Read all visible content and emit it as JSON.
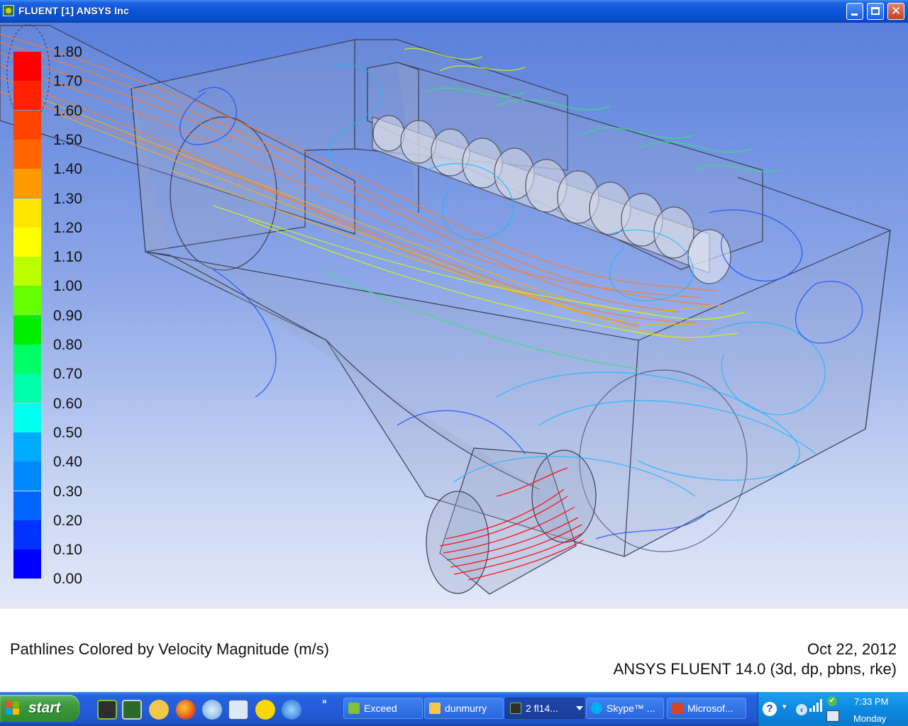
{
  "window": {
    "title": "FLUENT [1] ANSYS Inc",
    "buttons": [
      "minimize",
      "maximize",
      "close"
    ]
  },
  "legend": {
    "colors": [
      "#ff0000",
      "#ff2200",
      "#ff4400",
      "#ff6600",
      "#ff9900",
      "#ffc200",
      "#ffe600",
      "#ffff00",
      "#bbff00",
      "#66ff00",
      "#00ee00",
      "#00ff66",
      "#00ffaa",
      "#00ffee",
      "#00d4ff",
      "#00aaff",
      "#0088ff",
      "#0066ff",
      "#0033ff",
      "#0000ff"
    ],
    "labels": [
      "1.80",
      "1.70",
      "1.60",
      "1.50",
      "1.40",
      "1.30",
      "1.20",
      "1.10",
      "1.00",
      "0.90",
      "0.80",
      "0.70",
      "0.60",
      "0.50",
      "0.40",
      "0.30",
      "0.20",
      "0.10",
      "0.00"
    ]
  },
  "caption": {
    "title": "Pathlines Colored by Velocity Magnitude (m/s)",
    "date": "Oct 22, 2012",
    "version": "ANSYS FLUENT 14.0 (3d, dp, pbns, rke)"
  },
  "taskbar": {
    "start_label": "start",
    "quick_launch_more": "»",
    "quick_launch_icons": [
      "exceed-icon",
      "graphics-icon",
      "folder-icon",
      "firefox-icon",
      "globe-icon",
      "edit-icon",
      "arrow-icon",
      "internet-explorer-icon"
    ],
    "tasks": [
      {
        "label": "Exceed",
        "icon": "exceed-icon",
        "active": false
      },
      {
        "label": "dunmurry",
        "icon": "folder-icon",
        "active": false
      },
      {
        "label": "2 fl14...",
        "icon": "fluent-icon",
        "active": true
      },
      {
        "label": "Skype™ ...",
        "icon": "skype-icon",
        "active": false
      },
      {
        "label": "Microsof...",
        "icon": "powerpoint-icon",
        "active": false
      }
    ],
    "tray": {
      "help": "?",
      "time": "7:33 PM",
      "day": "Monday"
    }
  },
  "colors": {
    "titlebar": "#0b55d8",
    "viewport_top": "#5a80dc",
    "viewport_bottom": "#e2e8f8",
    "taskbar": "#245ddb",
    "start_button": "#3c9a3c"
  }
}
